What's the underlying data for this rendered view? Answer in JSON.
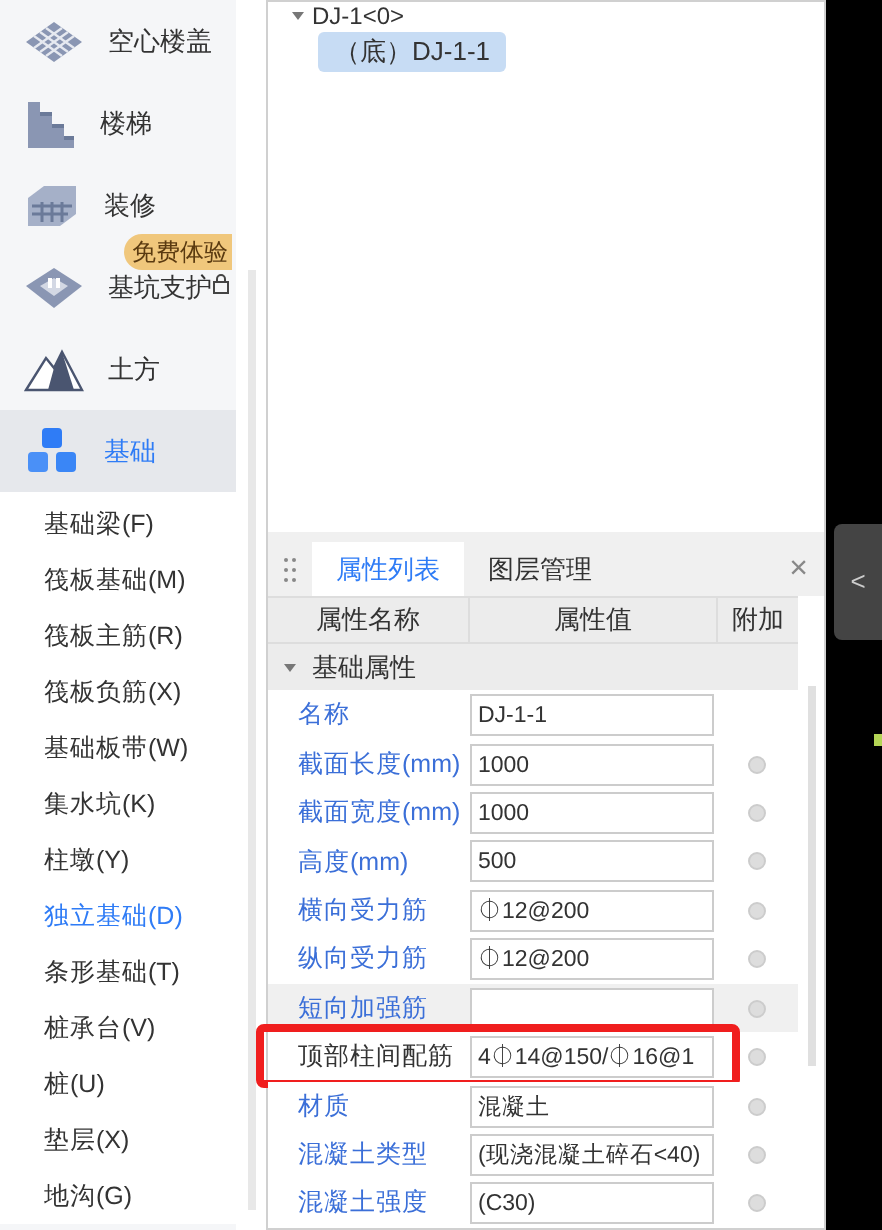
{
  "sidebar": {
    "categories": [
      {
        "label": "空心楼盖",
        "kind": "grid",
        "selected": false
      },
      {
        "label": "楼梯",
        "kind": "stairs",
        "selected": false
      },
      {
        "label": "装修",
        "kind": "panel",
        "selected": false
      },
      {
        "label": "基坑支护",
        "kind": "pit",
        "selected": false,
        "badge": "免费体验"
      },
      {
        "label": "土方",
        "kind": "mountain",
        "selected": false
      },
      {
        "label": "基础",
        "kind": "cubes",
        "selected": true
      }
    ],
    "items": [
      {
        "label": "基础梁(F)",
        "selected": false
      },
      {
        "label": "筏板基础(M)",
        "selected": false
      },
      {
        "label": "筏板主筋(R)",
        "selected": false
      },
      {
        "label": "筏板负筋(X)",
        "selected": false
      },
      {
        "label": "基础板带(W)",
        "selected": false
      },
      {
        "label": "集水坑(K)",
        "selected": false
      },
      {
        "label": "柱墩(Y)",
        "selected": false
      },
      {
        "label": "独立基础(D)",
        "selected": true
      },
      {
        "label": "条形基础(T)",
        "selected": false
      },
      {
        "label": "桩承台(V)",
        "selected": false
      },
      {
        "label": "桩(U)",
        "selected": false
      },
      {
        "label": "垫层(X)",
        "selected": false
      },
      {
        "label": "地沟(G)",
        "selected": false
      }
    ]
  },
  "tree": {
    "parent": "DJ-1<0>",
    "children": [
      {
        "label": "（底）DJ-1-1",
        "selected": true
      }
    ]
  },
  "properties": {
    "tabs": [
      {
        "label": "属性列表",
        "selected": true
      },
      {
        "label": "图层管理",
        "selected": false
      }
    ],
    "close": "×",
    "columns": [
      "属性名称",
      "属性值",
      "附加"
    ],
    "group": "基础属性",
    "rows": [
      {
        "name": "名称",
        "value": "DJ-1-1",
        "attach": false,
        "selected": false,
        "highlighted": false
      },
      {
        "name": "截面长度(mm)",
        "value": "1000",
        "attach": true,
        "selected": false,
        "highlighted": false
      },
      {
        "name": "截面宽度(mm)",
        "value": "1000",
        "attach": true,
        "selected": false,
        "highlighted": false
      },
      {
        "name": "高度(mm)",
        "value": "500",
        "attach": true,
        "selected": false,
        "highlighted": false
      },
      {
        "name": "横向受力筋",
        "value": "⏀12@200",
        "attach": true,
        "selected": false,
        "highlighted": false
      },
      {
        "name": "纵向受力筋",
        "value": "⏀12@200",
        "attach": true,
        "selected": false,
        "highlighted": false
      },
      {
        "name": "短向加强筋",
        "value": "",
        "attach": true,
        "selected": true,
        "highlighted": false
      },
      {
        "name": "顶部柱间配筋",
        "value": "4⏀14@150/⏀16@1",
        "attach": true,
        "selected": false,
        "highlighted": true
      },
      {
        "name": "材质",
        "value": "混凝土",
        "attach": true,
        "selected": false,
        "highlighted": false
      },
      {
        "name": "混凝土类型",
        "value": "(现浇混凝土碎石<40)",
        "attach": true,
        "selected": false,
        "highlighted": false
      },
      {
        "name": "混凝土强度",
        "value": "(C30)",
        "attach": true,
        "selected": false,
        "highlighted": false
      }
    ]
  },
  "collapse": "<"
}
